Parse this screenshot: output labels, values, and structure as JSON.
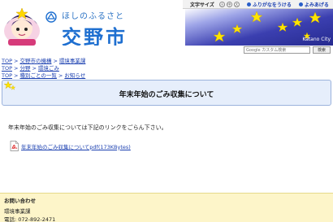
{
  "header": {
    "tagline": "ほしのふるさと",
    "city_name": "交野市",
    "city_en": "Katano City"
  },
  "utility": {
    "font_size_label": "文字サイズ",
    "size_buttons": [
      "小",
      "中",
      "大"
    ],
    "furigana_label": "ふりがなをうける",
    "read_aloud_label": "よみあげる"
  },
  "search": {
    "placeholder": "Google カスタム検索",
    "button_label": "検索"
  },
  "breadcrumbs": [
    [
      "TOP",
      "交野市の機構",
      "環境事業課"
    ],
    [
      "TOP",
      "分野",
      "環境ごみ"
    ],
    [
      "TOP",
      "種別ごとの一覧",
      "お知らせ"
    ]
  ],
  "page": {
    "title": "年末年始のごみ収集について",
    "lead": "年末年始のごみ収集については下記のリンクをごらん下さい。",
    "pdf_link": "年末年始のごみ収集についてpdf(173KBytes)"
  },
  "footer": {
    "heading": "お問い合わせ",
    "department": "環境事業課",
    "phone": "電話: 072-892-2471"
  },
  "colors": {
    "city_name": "#1e6fd0",
    "link": "#1a3fb0",
    "title_bg": "#e6eefb",
    "footer_bg": "#fdf5c9",
    "night_sky": "#2c2f9e"
  }
}
